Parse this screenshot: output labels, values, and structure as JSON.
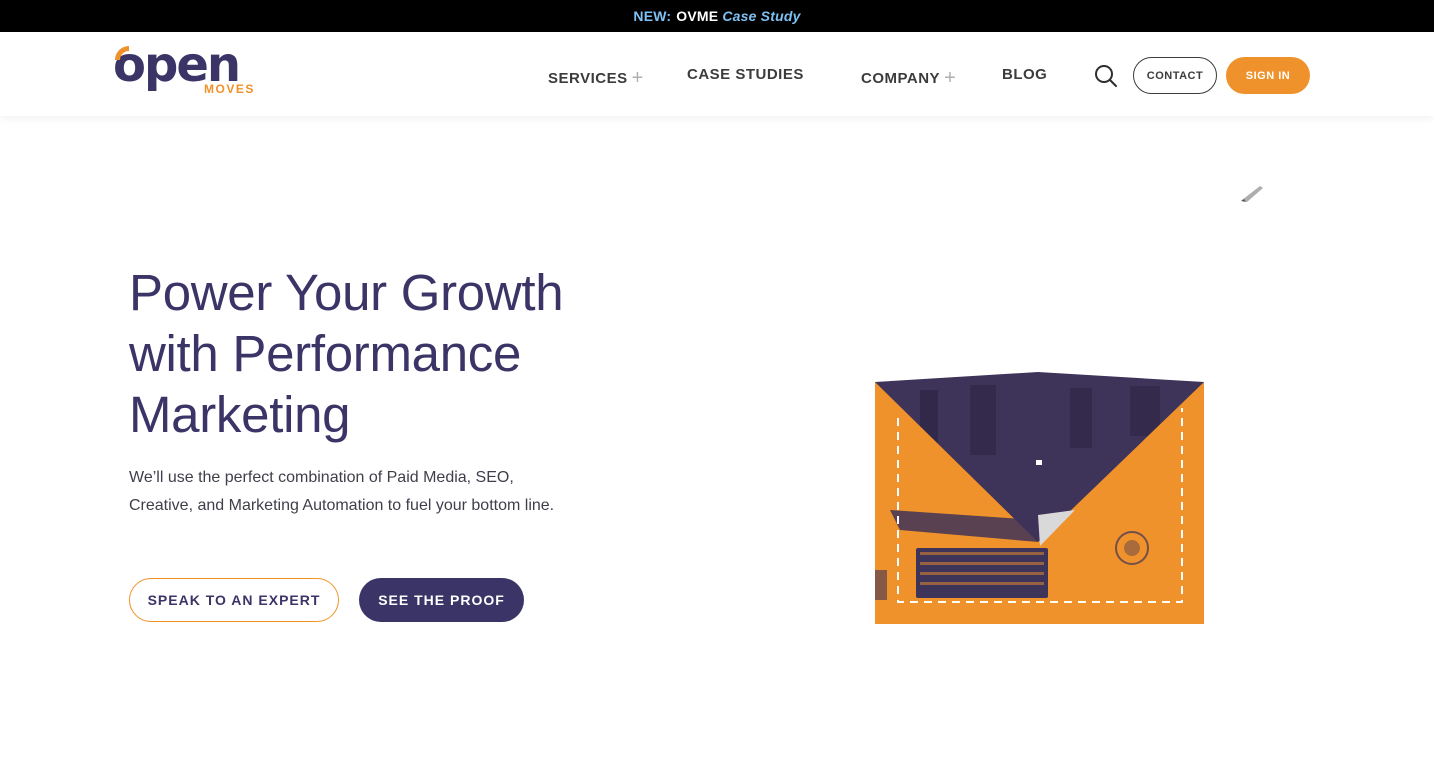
{
  "announcement": {
    "new_label": "NEW:",
    "highlight": "OVME",
    "link_text": "Case Study"
  },
  "brand": {
    "name": "open",
    "sub": "MOVES",
    "primary_color": "#3b3567",
    "accent_color": "#f0922b"
  },
  "nav": {
    "services": "SERVICES",
    "case_studies": "CASE STUDIES",
    "company": "COMPANY",
    "blog": "BLOG",
    "expand_symbol": "+"
  },
  "header_actions": {
    "contact": "CONTACT",
    "sign_in": "SIGN IN",
    "search_icon": "search-icon"
  },
  "hero": {
    "title_line1": "Power Your Growth",
    "title_line2": "with Performance",
    "title_line3": "Marketing",
    "subtitle_line1": "We’ll use the perfect combination of Paid Media, SEO,",
    "subtitle_line2": "Creative, and Marketing Automation to fuel your bottom line.",
    "cta_primary": "SPEAK TO AN EXPERT",
    "cta_secondary": "SEE THE PROOF"
  }
}
